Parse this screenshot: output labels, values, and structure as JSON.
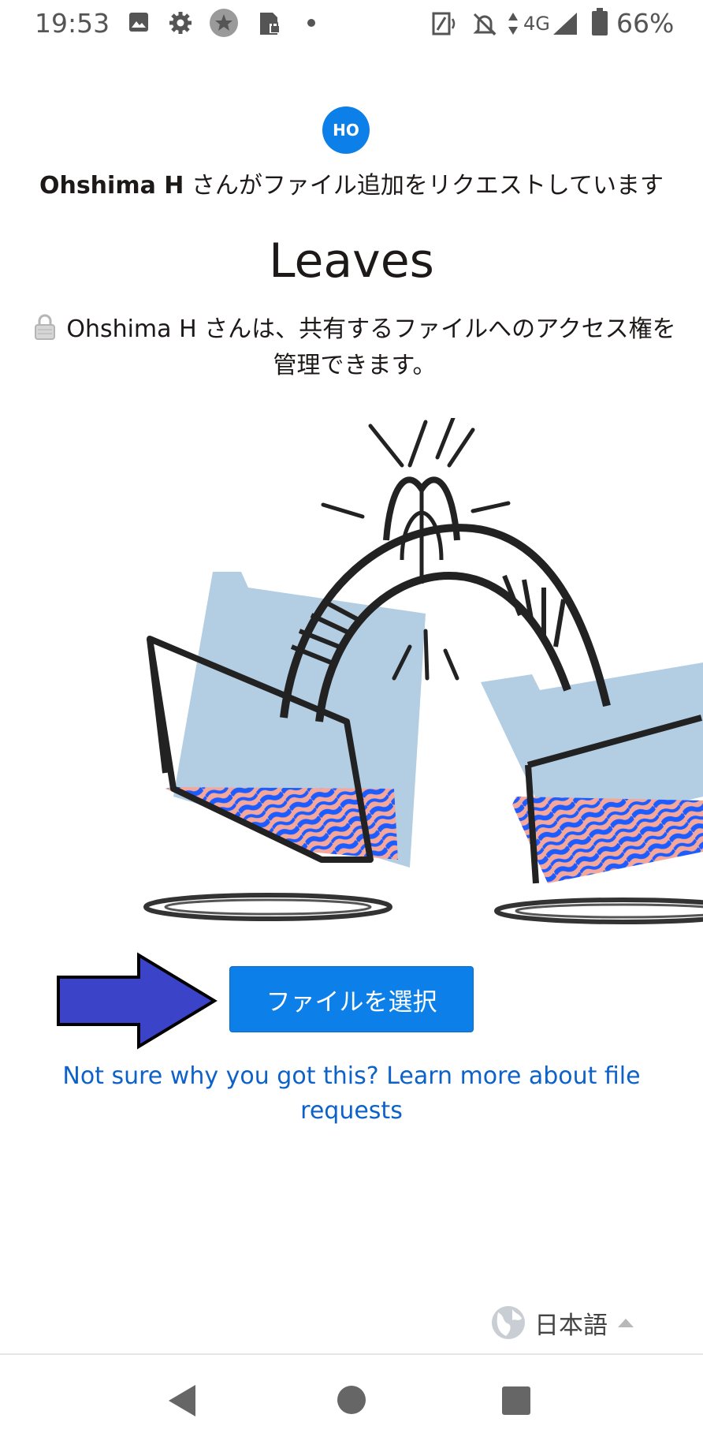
{
  "status_bar": {
    "time": "19:53",
    "network": "4G",
    "battery": "66%",
    "icons": [
      "image-icon",
      "settings-gear-icon",
      "star-badge-icon",
      "sd-card-lock-icon",
      "dot-icon",
      "nfc-icon",
      "bell-muted-icon",
      "data-arrows-icon",
      "signal-icon",
      "battery-icon"
    ]
  },
  "header": {
    "avatar_initials": "HO",
    "requester_name": "Ohshima H",
    "request_text": " さんがファイル追加をリクエストしています",
    "title": "Leaves",
    "access_note": "Ohshima H さんは、共有するファイルへのアクセス権を管理できます。"
  },
  "colors": {
    "accent": "#0d7fe8",
    "link": "#0d62c9",
    "folder_blue": "#b3cde3",
    "pattern_blue": "#1d5cff",
    "pattern_pink": "#f4a79a",
    "arrow": "#3b44c8"
  },
  "action": {
    "choose_label": "ファイルを選択",
    "learn_more": "Not sure why you got this? Learn more about file requests"
  },
  "language": {
    "label": "日本語",
    "icon": "globe-icon"
  },
  "nav": {
    "back": "back-triangle-icon",
    "home": "home-circle-icon",
    "recents": "recents-square-icon"
  }
}
